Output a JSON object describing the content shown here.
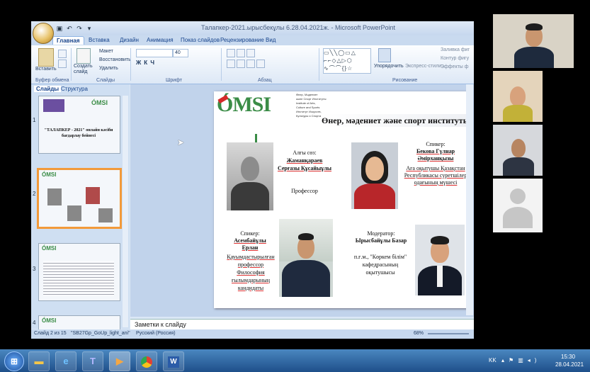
{
  "window": {
    "title": "Талапкер-2021.ырысбекұлы 6.28.04.2021ж. - Microsoft PowerPoint"
  },
  "ribbon": {
    "tabs": [
      "Главная",
      "Вставка",
      "Дизайн",
      "Анимация",
      "Показ слайдов",
      "Рецензирование",
      "Вид"
    ],
    "active_tab": "Главная",
    "clipboard": {
      "paste": "Вставить",
      "group": "Буфер обмена"
    },
    "slides_group": {
      "new_slide": "Создать слайд",
      "layout": "Макет",
      "reset": "Восстановить",
      "delete": "Удалить",
      "group": "Слайды"
    },
    "font_group": {
      "size": "40",
      "group": "Шрифт"
    },
    "paragraph_group": {
      "group": "Абзац"
    },
    "drawing_group": {
      "arrange": "Упорядочить",
      "quick_styles": "Экспресс-стили",
      "fill": "Заливка фиг",
      "outline": "Контур фигу",
      "effects": "Эффекты ф",
      "group": "Рисование"
    }
  },
  "slides_panel": {
    "tabs": [
      "Слайды",
      "Структура"
    ],
    "slides": [
      {
        "num": "1",
        "heading": "\"ТАЛАПКЕР - 2021\" онлайн кәсіби бағдарлау бейнесі"
      },
      {
        "num": "2"
      },
      {
        "num": "3"
      },
      {
        "num": "4"
      }
    ]
  },
  "slide": {
    "logo": "ÓMSI",
    "institute_lines": [
      "Өнер, Мәдениет",
      "және Спорт Институты",
      "Institute of Arts,",
      "Culture and Sports",
      "Институт Искусств,",
      "Культуры и Спорта"
    ],
    "title": "Өнер, мәдениет және спорт институты",
    "speaker1": {
      "role": "Алғы сөз:",
      "name": "Жаманқараев Серғазы Құсайыұлы",
      "title": "Профессор"
    },
    "speaker2": {
      "role": "Спикер:",
      "name": "Бекова Гүлнар Әмірханқызы",
      "title": "Аға оқытушы Қазақстан Республикасы суретшілер одағының мүшесі"
    },
    "speaker3": {
      "role": "Спикер:",
      "name": "Асембайұлы Ерлан",
      "title": "Қауымдастырылған профессор Философия ғылымдарының кандидаты"
    },
    "speaker4": {
      "role": "Модератор:",
      "name": "Ырысбайұлы Базар",
      "title": "п.ғ.м., \"Көркем білім\" кафедрасының оқытушысы"
    }
  },
  "notes": {
    "placeholder": "Заметки к слайду"
  },
  "status": {
    "slide_count": "Слайд 2 из 15",
    "theme": "\"SB27Gp_GoUp_light_ani\"",
    "language": "Русский (Россия)",
    "zoom": "68%"
  },
  "taskbar": {
    "lang": "KK",
    "time": "15:30",
    "date": "28.04.2021",
    "apps": [
      "file-explorer",
      "internet-explorer",
      "teams",
      "media-player",
      "chrome",
      "word"
    ]
  }
}
